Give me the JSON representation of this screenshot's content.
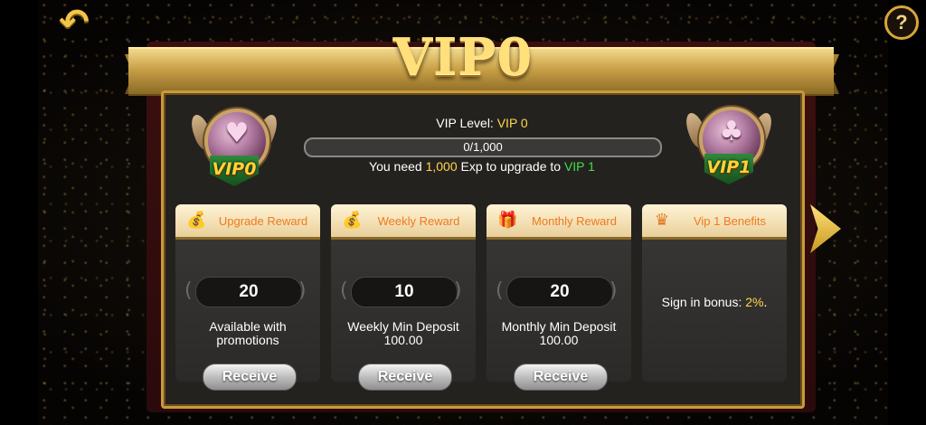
{
  "header": {
    "title": "VIP0",
    "back_icon": "back-arrow-icon",
    "help_label": "?"
  },
  "level": {
    "label": "VIP Level:",
    "value": "VIP 0",
    "current_badge": "VIP0",
    "next_badge": "VIP1",
    "progress_text": "0/1,000",
    "progress_fraction": 0,
    "need_prefix": "You need",
    "need_amount": "1,000",
    "need_middle": "Exp to upgrade to",
    "next_level": "VIP 1"
  },
  "cards": [
    {
      "title": "Upgrade Reward",
      "icon": "money-bag-icon",
      "value": "20",
      "desc": "Available with promotions",
      "button": "Receive"
    },
    {
      "title": "Weekly Reward",
      "icon": "money-bag-icon",
      "value": "10",
      "desc": "Weekly Min Deposit 100.00",
      "button": "Receive"
    },
    {
      "title": "Monthly Reward",
      "icon": "gift-icon",
      "value": "20",
      "desc": "Monthly Min Deposit 100.00",
      "button": "Receive"
    }
  ],
  "benefits": {
    "title_vip": "Vip 1",
    "title_rest": "Benefits",
    "icon": "crown-icon",
    "text_prefix": "Sign in bonus:",
    "text_value": "2%",
    "text_suffix": "."
  },
  "colors": {
    "gold": "#ffd64a",
    "green": "#3fe04a",
    "orange": "#f07a1e"
  }
}
